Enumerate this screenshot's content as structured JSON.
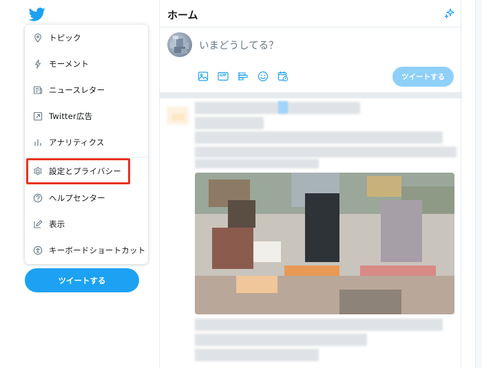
{
  "colors": {
    "accent": "#1da1f2",
    "accent_disabled": "#8ed0f9",
    "highlight": "#e8321e"
  },
  "nav": {
    "logo_icon": "twitter-bird-icon",
    "menu": [
      {
        "label": "トピック",
        "icon": "topic-icon"
      },
      {
        "label": "モーメント",
        "icon": "moment-icon"
      },
      {
        "label": "ニュースレター",
        "icon": "newsletter-icon"
      },
      {
        "label": "Twitter広告",
        "icon": "external-link-icon"
      },
      {
        "label": "アナリティクス",
        "icon": "analytics-icon"
      },
      {
        "label": "設定とプライバシー",
        "icon": "gear-icon"
      },
      {
        "label": "ヘルプセンター",
        "icon": "help-icon"
      },
      {
        "label": "表示",
        "icon": "display-icon"
      },
      {
        "label": "キーボードショートカット",
        "icon": "accessibility-icon"
      }
    ],
    "tweet_button": "ツイートする"
  },
  "main": {
    "title": "ホーム",
    "compose": {
      "placeholder": "いまどうしてる？",
      "tools": [
        "image-icon",
        "gif-icon",
        "poll-icon",
        "emoji-icon",
        "schedule-icon"
      ],
      "gif_label": "GIF",
      "tweet_button": "ツイートする"
    }
  }
}
